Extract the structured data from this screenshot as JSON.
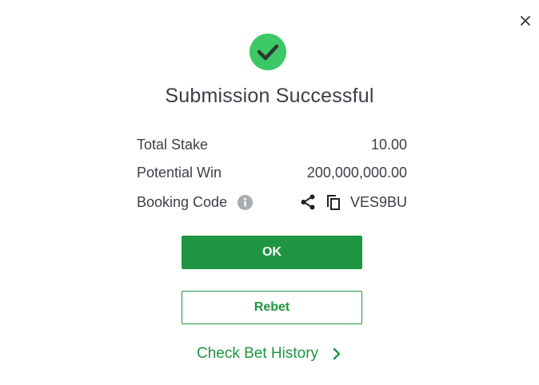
{
  "dialog": {
    "title": "Submission Successful",
    "close_icon": "close-icon",
    "success_icon": "check-circle-icon",
    "accent_color": "#1e9641",
    "success_color": "#3cc866"
  },
  "summary": {
    "total_stake_label": "Total Stake",
    "total_stake_value": "10.00",
    "potential_win_label": "Potential Win",
    "potential_win_value": "200,000,000.00",
    "booking_code_label": "Booking Code",
    "booking_code_value": "VES9BU",
    "info_icon": "info-icon",
    "share_icon": "share-icon",
    "copy_icon": "copy-icon"
  },
  "actions": {
    "ok_label": "OK",
    "rebet_label": "Rebet",
    "history_label": "Check Bet History",
    "history_icon": "chevron-right-icon"
  }
}
